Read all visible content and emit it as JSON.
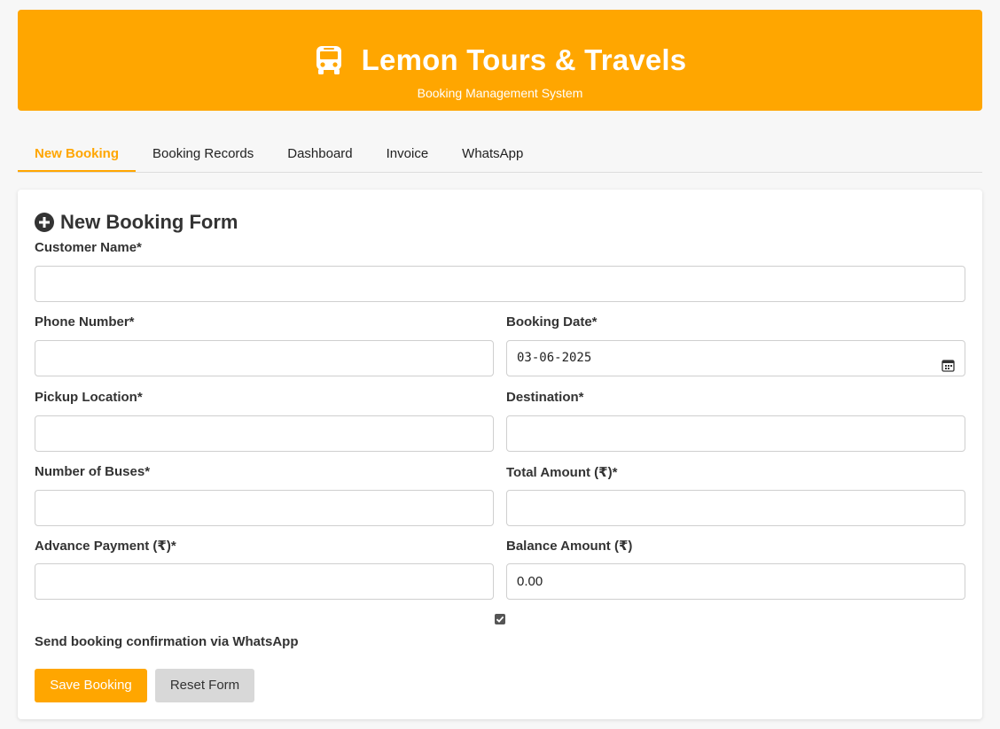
{
  "header": {
    "title": "Lemon Tours & Travels",
    "subtitle": "Booking Management System",
    "icon": "bus-icon",
    "brand_color": "#ffa600"
  },
  "tabs": [
    {
      "label": "New Booking",
      "active": true
    },
    {
      "label": "Booking Records",
      "active": false
    },
    {
      "label": "Dashboard",
      "active": false
    },
    {
      "label": "Invoice",
      "active": false
    },
    {
      "label": "WhatsApp",
      "active": false
    }
  ],
  "form": {
    "title": "New Booking Form",
    "title_icon": "plus-circle-icon",
    "fields": {
      "customer_name": {
        "label": "Customer Name*",
        "value": ""
      },
      "phone_number": {
        "label": "Phone Number*",
        "value": ""
      },
      "booking_date": {
        "label": "Booking Date*",
        "value": "03-06-2025"
      },
      "pickup_location": {
        "label": "Pickup Location*",
        "value": ""
      },
      "destination": {
        "label": "Destination*",
        "value": ""
      },
      "number_of_buses": {
        "label": "Number of Buses*",
        "value": ""
      },
      "total_amount": {
        "label": "Total Amount (₹)*",
        "value": ""
      },
      "advance_payment": {
        "label": "Advance Payment (₹)*",
        "value": ""
      },
      "balance_amount": {
        "label": "Balance Amount (₹)",
        "value": "0.00"
      }
    },
    "whatsapp_confirmation": {
      "label": "Send booking confirmation via WhatsApp",
      "checked": true
    },
    "save_label": "Save Booking",
    "reset_label": "Reset Form"
  }
}
